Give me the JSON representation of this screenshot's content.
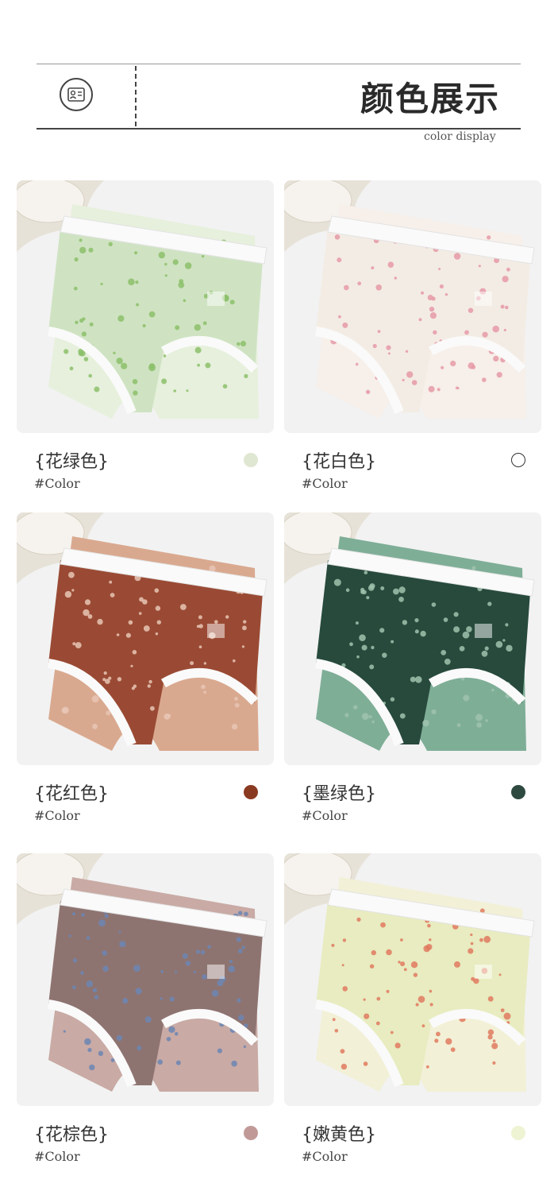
{
  "header": {
    "title": "颜色展示",
    "subtitle": "color display",
    "icon": "profile-card-icon"
  },
  "products": [
    {
      "name": "{花绿色}",
      "code": "#Color",
      "swatch": "#dfe6d2",
      "fabric": "#cfe3c2",
      "print": "#8cc06a",
      "lining": "#e6f0dc"
    },
    {
      "name": "{花白色}",
      "code": "#Color",
      "swatch": "#ffffff",
      "fabric": "#f3ece4",
      "print": "#e59aa7",
      "lining": "#f7efe9"
    },
    {
      "name": "{花红色}",
      "code": "#Color",
      "swatch": "#8b3a22",
      "fabric": "#9a4a34",
      "print": "#e8c6b5",
      "lining": "#d9a98f"
    },
    {
      "name": "{墨绿色}",
      "code": "#Color",
      "swatch": "#2e4a40",
      "fabric": "#274a3c",
      "print": "#9fc2ad",
      "lining": "#7fae97"
    },
    {
      "name": "{花棕色}",
      "code": "#Color",
      "swatch": "#c19a98",
      "fabric": "#8e7471",
      "print": "#6c86b3",
      "lining": "#c9aaa5"
    },
    {
      "name": "{嫩黄色}",
      "code": "#Color",
      "swatch": "#eef3d3",
      "fabric": "#e8ecc0",
      "print": "#e07a5f",
      "lining": "#f2f0d6"
    }
  ]
}
